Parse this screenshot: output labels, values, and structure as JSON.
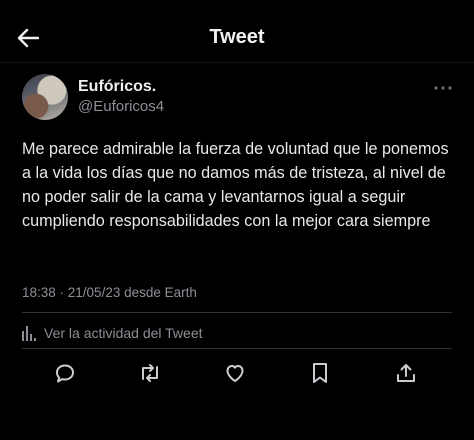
{
  "header": {
    "title": "Tweet",
    "back_icon": "arrow-left-icon"
  },
  "tweet": {
    "author": {
      "display_name": "Eufóricos.",
      "handle": "@Euforicos4"
    },
    "text": "Me parece admirable la fuerza de voluntad que le ponemos a la vida los días que no damos más de tristeza, al nivel de no poder salir de la cama y levantarnos igual a seguir cumpliendo responsabilidades con la mejor cara siempre",
    "meta": "18:38 · 21/05/23 desde Earth",
    "activity_label": "Ver la actividad del Tweet"
  },
  "actions": [
    "reply-icon",
    "retweet-icon",
    "like-icon",
    "bookmark-icon",
    "share-icon"
  ],
  "colors": {
    "background": "#000000",
    "text": "#e7e9ea",
    "secondary": "#8b9096",
    "divider": "#2f3336"
  }
}
